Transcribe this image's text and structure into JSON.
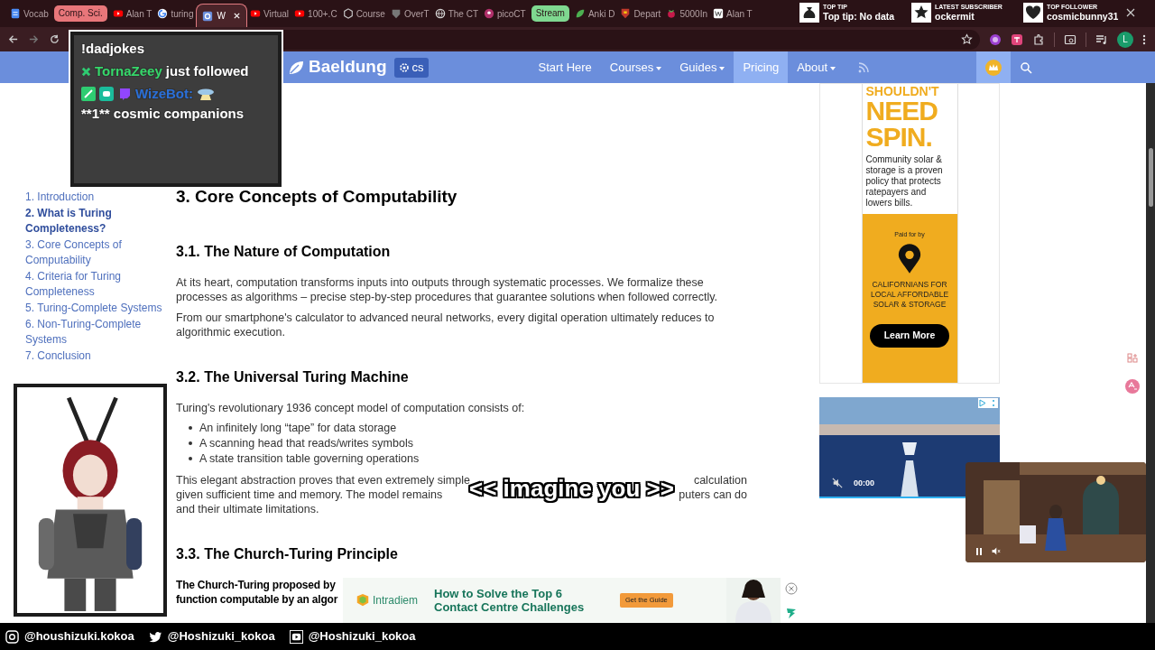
{
  "browser": {
    "tabs": [
      {
        "kind": "tab",
        "label": "Vocab",
        "selected": false
      },
      {
        "kind": "group",
        "label": "Comp. Sci.",
        "color": "#e8767a"
      },
      {
        "kind": "tab",
        "label": "Alan T",
        "selected": false
      },
      {
        "kind": "tab",
        "label": "turing",
        "selected": false
      },
      {
        "kind": "tab",
        "label": "W",
        "selected": true
      },
      {
        "kind": "tab",
        "label": "Virtual",
        "selected": false
      },
      {
        "kind": "tab",
        "label": "100+.C",
        "selected": false
      },
      {
        "kind": "tab",
        "label": "Course",
        "selected": false
      },
      {
        "kind": "tab",
        "label": "OverT",
        "selected": false
      },
      {
        "kind": "tab",
        "label": "The CT",
        "selected": false
      },
      {
        "kind": "tab",
        "label": "picoCT",
        "selected": false
      },
      {
        "kind": "group",
        "label": "Stream",
        "color": "#7fd890"
      },
      {
        "kind": "tab",
        "label": "Anki D",
        "selected": false
      },
      {
        "kind": "tab",
        "label": "Depart",
        "selected": false
      },
      {
        "kind": "tab",
        "label": "5000In",
        "selected": false
      },
      {
        "kind": "tab",
        "label": "Alan T",
        "selected": false
      }
    ],
    "profile_initial": "L"
  },
  "stream_widgets": [
    {
      "heading": "TOP TIP",
      "value": "Top tip: No data"
    },
    {
      "heading": "LATEST SUBSCRIBER",
      "value": "ockermit"
    },
    {
      "heading": "TOP FOLLOWER",
      "value": "cosmicbunny31"
    }
  ],
  "chat": [
    {
      "kind": "command",
      "text": "!dadjokes"
    },
    {
      "kind": "follow",
      "user": "TornaZeey",
      "text": "just followed"
    },
    {
      "kind": "bot",
      "user": "WizeBot:",
      "text": "**1** cosmic companions"
    }
  ],
  "site_nav": {
    "brand": "Baeldung",
    "badge": "cs",
    "items": [
      {
        "label": "Start Here",
        "dropdown": false,
        "selected": false
      },
      {
        "label": "Courses",
        "dropdown": true,
        "selected": false
      },
      {
        "label": "Guides",
        "dropdown": true,
        "selected": false
      },
      {
        "label": "Pricing",
        "dropdown": false,
        "selected": true
      },
      {
        "label": "About",
        "dropdown": true,
        "selected": false
      }
    ]
  },
  "toc": [
    {
      "label": "1. Introduction",
      "selected": false
    },
    {
      "label": "2. What is Turing Completeness?",
      "selected": true
    },
    {
      "label": "3. Core Concepts of Computability",
      "selected": false
    },
    {
      "label": "4. Criteria for Turing Completeness",
      "selected": false
    },
    {
      "label": "5. Turing-Complete Systems",
      "selected": false
    },
    {
      "label": "6. Non-Turing-Complete Systems",
      "selected": false
    },
    {
      "label": "7. Conclusion",
      "selected": false
    }
  ],
  "article": [
    {
      "kind": "h2",
      "text": "3. Core Concepts of Computability"
    },
    {
      "kind": "h3",
      "text": "3.1. The Nature of Computation"
    },
    {
      "kind": "p",
      "text": "At its heart, computation transforms inputs into outputs through systematic processes. We formalize these processes as algorithms – precise step-by-step procedures that guarantee solutions when followed correctly."
    },
    {
      "kind": "p",
      "text": "From our smartphone's calculator to advanced neural networks, every digital operation ultimately reduces to algorithmic execution."
    },
    {
      "kind": "h3",
      "text": "3.2. The Universal Turing Machine"
    },
    {
      "kind": "p",
      "text": "Turing's revolutionary 1936 concept model of computation consists of:"
    },
    {
      "kind": "ul",
      "items": [
        "An infinitely long “tape” for data storage",
        "A scanning head that reads/writes symbols",
        "A state transition table governing operations"
      ]
    },
    {
      "kind": "fragments",
      "lines": [
        [
          "This elegant abstraction proves that even extremely simple",
          "calculation"
        ],
        [
          "given sufficient time and memory. The model remains",
          "puters can do"
        ],
        [
          "and their ultimate limitations."
        ]
      ]
    },
    {
      "kind": "h3",
      "text": "3.3. The Church-Turing Principle"
    },
    {
      "kind": "bold_lines",
      "lines": [
        "The Church-Turing proposed by",
        "function computable by an algor"
      ]
    }
  ],
  "caption": "<< imagine you >>",
  "sidebar_ad": {
    "headline_small": "SHOULDN'T",
    "headline": "NEED SPIN.",
    "body": "Community solar & storage is a proven policy that protects ratepayers and lowers bills.",
    "paid_for": "Paid for by",
    "sponsor": "CALIFORNIANS FOR LOCAL AFFORDABLE SOLAR & STORAGE",
    "button": "Learn More"
  },
  "video_ad": {
    "time": "00:00",
    "muted": true
  },
  "floating_video": {
    "playing": true,
    "muted": true
  },
  "bottom_ad": {
    "brand": "Intradiem",
    "headline": "How to Solve the Top 6 Contact Centre Challenges",
    "button": "Get the Guide"
  },
  "socials": [
    {
      "handle": "@houshizuki.kokoa"
    },
    {
      "handle": "@Hoshizuki_kokoa"
    },
    {
      "handle": "@Hoshizuki_kokoa"
    }
  ]
}
